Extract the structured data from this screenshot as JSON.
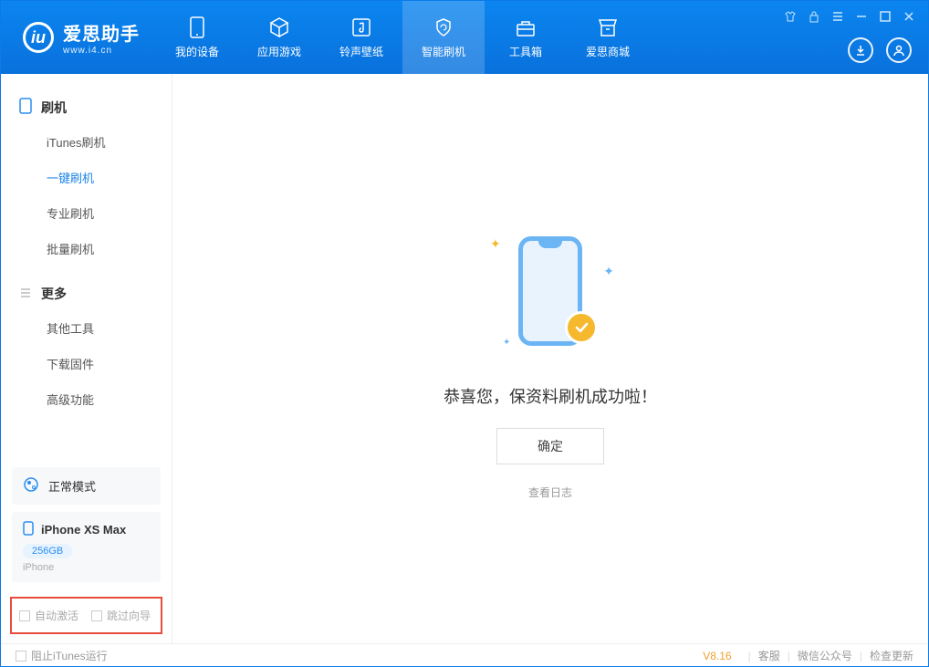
{
  "app": {
    "name": "爱思助手",
    "domain": "www.i4.cn"
  },
  "nav": {
    "tabs": [
      {
        "label": "我的设备"
      },
      {
        "label": "应用游戏"
      },
      {
        "label": "铃声壁纸"
      },
      {
        "label": "智能刷机"
      },
      {
        "label": "工具箱"
      },
      {
        "label": "爱思商城"
      }
    ]
  },
  "sidebar": {
    "section1_title": "刷机",
    "section1_items": [
      "iTunes刷机",
      "一键刷机",
      "专业刷机",
      "批量刷机"
    ],
    "section2_title": "更多",
    "section2_items": [
      "其他工具",
      "下载固件",
      "高级功能"
    ],
    "mode_card": "正常模式",
    "device": {
      "name": "iPhone XS Max",
      "storage": "256GB",
      "type": "iPhone"
    },
    "bottom_options": [
      "自动激活",
      "跳过向导"
    ]
  },
  "main": {
    "success_message": "恭喜您，保资料刷机成功啦！",
    "ok_button": "确定",
    "view_log": "查看日志"
  },
  "footer": {
    "block_itunes": "阻止iTunes运行",
    "version": "V8.16",
    "links": [
      "客服",
      "微信公众号",
      "检查更新"
    ]
  }
}
